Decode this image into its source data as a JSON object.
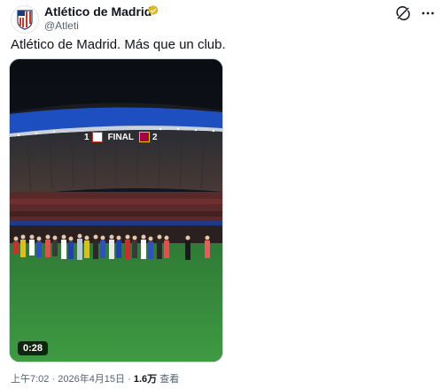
{
  "tweet": {
    "display_name": "Atlético de Madrid",
    "handle": "@Atleti",
    "text": "Atlético de Madrid. Más que un club.",
    "verified_color": "#e2b719",
    "avatar_icon": "atletico-crest-icon"
  },
  "media": {
    "duration": "0:28",
    "scoreboard": {
      "home_score": "1",
      "label": "FINAL",
      "away_score": "2"
    }
  },
  "meta": {
    "time": "上午7:02",
    "date": "2026年4月15日",
    "views_count": "1.6万",
    "views_label": "查看",
    "separator": "·"
  }
}
